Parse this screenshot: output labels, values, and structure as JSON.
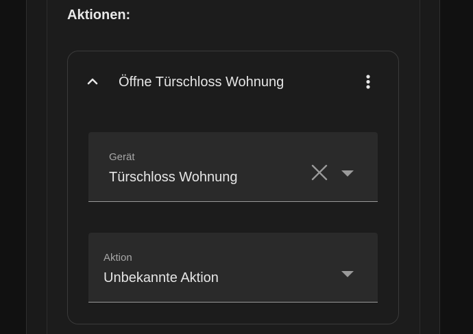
{
  "section": {
    "title": "Aktionen:"
  },
  "action_card": {
    "title": "Öffne Türschloss Wohnung",
    "expanded_icon": "chevron-up-icon",
    "menu_icon": "dots-vertical-icon",
    "device_field": {
      "label": "Gerät",
      "value": "Türschloss Wohnung",
      "clear_icon": "close-icon",
      "dropdown_icon": "menu-down-icon"
    },
    "action_field": {
      "label": "Aktion",
      "value": "Unbekannte Aktion",
      "dropdown_icon": "menu-down-icon"
    }
  },
  "colors": {
    "background": "#111111",
    "card_background": "#1c1c1c",
    "field_background": "#2a2a2a",
    "text_primary": "#e6e6e6",
    "text_secondary": "#a8a8a8",
    "border": "#3b3b3b"
  }
}
